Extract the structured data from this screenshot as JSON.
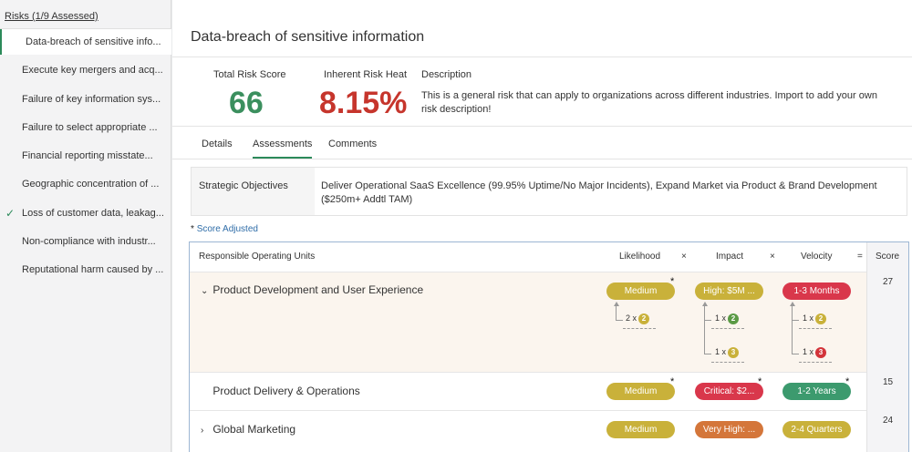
{
  "sidebar": {
    "header": "Risks (1/9 Assessed)",
    "items": [
      {
        "label": "Data-breach of sensitive info..."
      },
      {
        "label": "Execute key mergers and acq..."
      },
      {
        "label": "Failure of key information sys..."
      },
      {
        "label": "Failure to select appropriate ..."
      },
      {
        "label": "Financial reporting misstate..."
      },
      {
        "label": "Geographic concentration of ..."
      },
      {
        "label": "Loss of customer data, leakag..."
      },
      {
        "label": "Non-compliance with industr..."
      },
      {
        "label": "Reputational harm caused by ..."
      }
    ]
  },
  "header": {
    "title": "Data-breach of sensitive information"
  },
  "metrics": {
    "total_label": "Total Risk Score",
    "total_value": "66",
    "heat_label": "Inherent Risk Heat",
    "heat_value": "8.15%",
    "description_label": "Description",
    "description_text": "This is a general risk that can apply to organizations across different industries. Import to add your own risk description!"
  },
  "tabs": [
    {
      "label": "Details"
    },
    {
      "label": "Assessments"
    },
    {
      "label": "Comments"
    }
  ],
  "objectives": {
    "label": "Strategic Objectives",
    "text": "Deliver Operational SaaS Excellence (99.95% Uptime/No Major Incidents), Expand Market via Product & Brand Development ($250m+ Addtl TAM)"
  },
  "score_adjusted": {
    "star": "*",
    "label": "Score Adjusted"
  },
  "table": {
    "headers": {
      "units": "Responsible Operating Units",
      "likelihood": "Likelihood",
      "x1": "×",
      "impact": "Impact",
      "x2": "×",
      "velocity": "Velocity",
      "eq": "=",
      "score": "Score"
    },
    "rows": [
      {
        "chevron": "⌄",
        "name": "Product Development and User Experience",
        "likelihood": "Medium",
        "impact": "High: $5M ...",
        "velocity": "1-3 Months",
        "score": "27",
        "star": "*",
        "likelihood_factor": {
          "mult": "2 x",
          "badge": "2"
        },
        "impact_factors": [
          {
            "mult": "1 x",
            "badge": "2"
          },
          {
            "mult": "1 x",
            "badge": "3"
          }
        ],
        "velocity_factors": [
          {
            "mult": "1 x",
            "badge": "2"
          },
          {
            "mult": "1 x",
            "badge": "3"
          }
        ]
      },
      {
        "chevron": "",
        "name": "Product Delivery & Operations",
        "likelihood": "Medium",
        "impact": "Critical: $2...",
        "velocity": "1-2 Years",
        "score": "15",
        "star": "*"
      },
      {
        "chevron": "›",
        "name": "Global Marketing",
        "likelihood": "Medium",
        "impact": "Very High: ...",
        "velocity": "2-4 Quarters",
        "score": "24"
      }
    ]
  },
  "colors": {
    "accent_green": "#2c8a5a",
    "total_score": "#3b8f5e",
    "heat_score": "#c6352c",
    "pill_yellow": "#c9b13a",
    "pill_red": "#d9374b",
    "pill_green": "#3c9a6e",
    "pill_orange": "#d4763a"
  },
  "icons": {
    "check": "check-icon",
    "chevron_down": "chevron-down-icon",
    "chevron_right": "chevron-right-icon",
    "arrow_up": "arrow-up-icon"
  }
}
